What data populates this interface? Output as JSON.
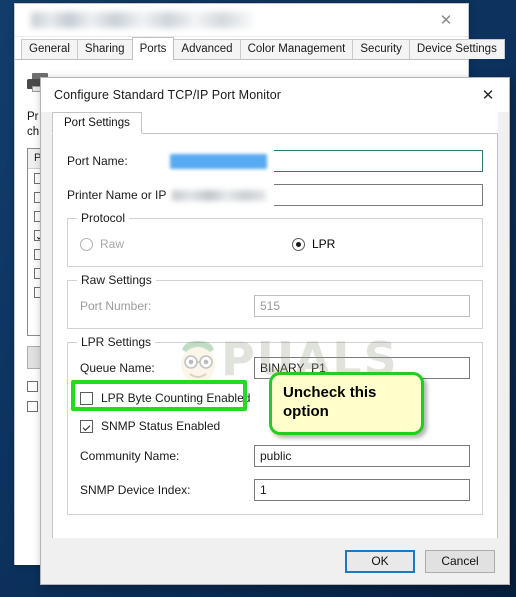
{
  "desktop": {
    "background_color": "#0d3562"
  },
  "properties_window": {
    "title": "",
    "title_redacted": true,
    "close_label": "✕",
    "tabs": [
      {
        "label": "General",
        "active": false
      },
      {
        "label": "Sharing",
        "active": false
      },
      {
        "label": "Ports",
        "active": true
      },
      {
        "label": "Advanced",
        "active": false
      },
      {
        "label": "Color Management",
        "active": false
      },
      {
        "label": "Security",
        "active": false
      },
      {
        "label": "Device Settings",
        "active": false
      }
    ],
    "printer_name": "",
    "hint_line1": "Pr",
    "hint_line2": "ch",
    "ports_header": [
      "P",
      "",
      ""
    ],
    "ports_rows": [
      {
        "checked": false
      },
      {
        "checked": false
      },
      {
        "checked": false
      },
      {
        "checked": true
      },
      {
        "checked": false
      },
      {
        "checked": false
      },
      {
        "checked": false
      }
    ],
    "buttons": [
      "",
      "",
      ""
    ],
    "check_options": [
      {
        "checked": false
      },
      {
        "checked": false
      }
    ]
  },
  "config_dialog": {
    "title": "Configure Standard TCP/IP Port Monitor",
    "close_label": "✕",
    "tab": {
      "label": "Port Settings",
      "active": true
    },
    "fields": {
      "port_name": {
        "label": "Port Name:",
        "value": "",
        "redacted": true,
        "focused": true
      },
      "printer_name": {
        "label": "Printer Name or IP Address:",
        "value": "",
        "redacted": true,
        "focused": false
      }
    },
    "protocol_group": {
      "legend": "Protocol",
      "options": [
        {
          "label": "Raw",
          "selected": false,
          "disabled": true
        },
        {
          "label": "LPR",
          "selected": true,
          "disabled": false
        }
      ]
    },
    "raw_settings_group": {
      "legend": "Raw Settings",
      "disabled": true,
      "port_number": {
        "label": "Port Number:",
        "value": "515"
      }
    },
    "lpr_settings_group": {
      "legend": "LPR Settings",
      "queue_name": {
        "label": "Queue Name:",
        "value": "BINARY_P1"
      },
      "byte_counting": {
        "label": "LPR Byte Counting Enabled",
        "checked": false
      }
    },
    "snmp": {
      "status_enabled": {
        "label": "SNMP Status Enabled",
        "checked": true
      },
      "community_name": {
        "label": "Community Name:",
        "value": "public"
      },
      "device_index": {
        "label": "SNMP Device Index:",
        "value": "1"
      }
    },
    "footer": {
      "ok_label": "OK",
      "cancel_label": "Cancel"
    }
  },
  "annotation": {
    "callout_text": "Uncheck this option",
    "callout_bg": "#ffffcc",
    "callout_border": "#22cc22",
    "highlight_border": "#21dd21"
  },
  "watermark": {
    "text": "PUALS",
    "full_text": "APPUALS"
  }
}
